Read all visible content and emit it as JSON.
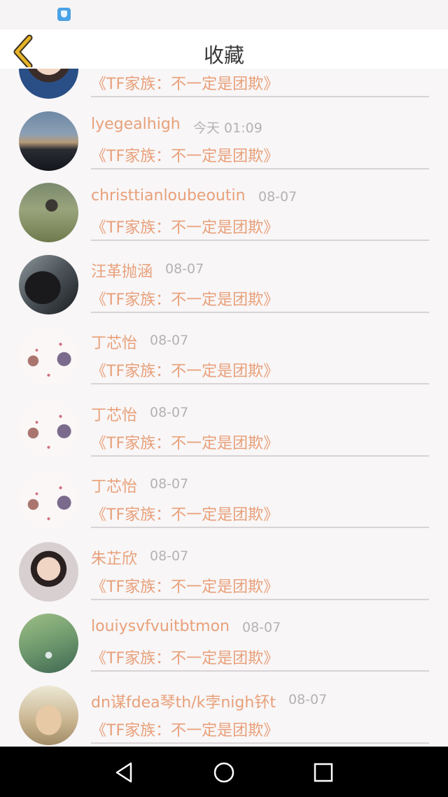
{
  "header": {
    "title": "收藏"
  },
  "items": [
    {
      "name": "",
      "time": "",
      "title": "《TF家族：不一定是团欺》",
      "avatar": "boy-portrait"
    },
    {
      "name": "lyegealhigh",
      "time": "今天 01:09",
      "title": "《TF家族：不一定是团欺》",
      "avatar": "dusk-sky"
    },
    {
      "name": "christtianloubeoutin",
      "time": "08-07",
      "title": "《TF家族：不一定是团欺》",
      "avatar": "grass-field"
    },
    {
      "name": "汪革抛涵",
      "time": "08-07",
      "title": "《TF家族：不一定是团欺》",
      "avatar": "dark-window"
    },
    {
      "name": "丁芯怡",
      "time": "08-07",
      "title": "《TF家族：不一定是团欺》",
      "avatar": "hearts-group"
    },
    {
      "name": "丁芯怡",
      "time": "08-07",
      "title": "《TF家族：不一定是团欺》",
      "avatar": "hearts-group"
    },
    {
      "name": "丁芯怡",
      "time": "08-07",
      "title": "《TF家族：不一定是团欺》",
      "avatar": "hearts-group"
    },
    {
      "name": "朱芷欣",
      "time": "08-07",
      "title": "《TF家族：不一定是团欺》",
      "avatar": "boy-portrait"
    },
    {
      "name": "louiysvfvuitbtmon",
      "time": "08-07",
      "title": "《TF家族：不一定是团欺》",
      "avatar": "green-bell"
    },
    {
      "name": "dn谋fdea琴th/k孛nigh钚t",
      "time": "08-07",
      "title": "《TF家族：不一定是团欺》",
      "avatar": "hands"
    }
  ],
  "icons": {
    "back": "chevron-left-icon",
    "nav_back": "triangle-back-icon",
    "nav_home": "circle-home-icon",
    "nav_recent": "square-recent-icon"
  },
  "colors": {
    "accent": "#e8a07a",
    "back_icon": "#e6b429",
    "time": "#b6b2b3",
    "background": "#f8f6f7",
    "nav_bar": "#000000"
  }
}
